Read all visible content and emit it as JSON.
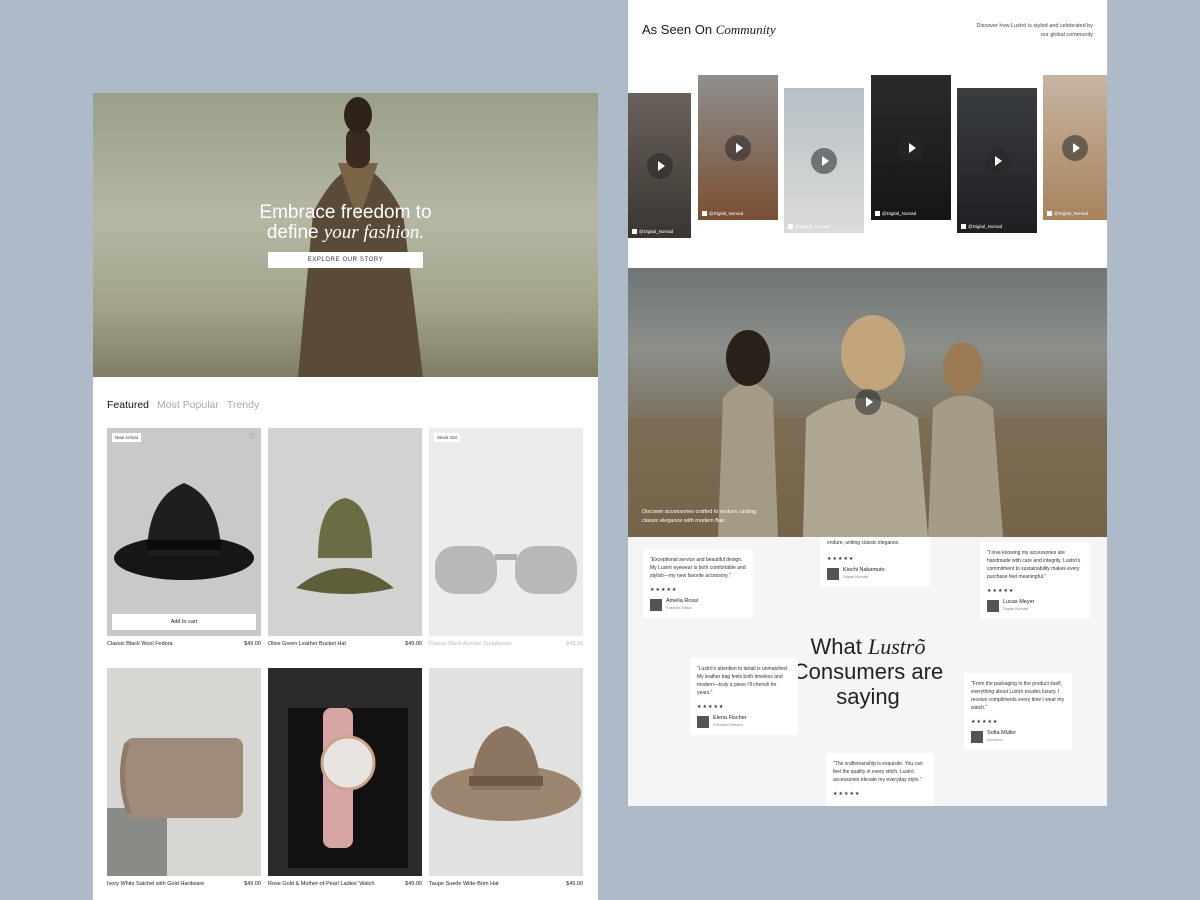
{
  "hero": {
    "title_line1": "Embrace freedom to",
    "title_line2_plain": "define ",
    "title_line2_italic": "your fashion.",
    "cta": "EXPLORE OUR STORY"
  },
  "tabs": [
    "Featured",
    "Most Popular",
    "Trendy"
  ],
  "products": [
    {
      "name": "Classic Black Wool Fedora",
      "price": "$49.00",
      "badge": "New Arrival",
      "cta": "Add to cart"
    },
    {
      "name": "Olive Green Leather Bucket Hat",
      "price": "$49.00"
    },
    {
      "name": "Classic Black Acetate Sunglasses",
      "price": "$49.00",
      "badge": "Stock Out"
    },
    {
      "name": "Ivory White Satchel with Gold Hardware",
      "price": "$49.00"
    },
    {
      "name": "Rose Gold & Mother-of-Pearl Ladies' Watch",
      "price": "$49.00"
    },
    {
      "name": "Taupe Suede Wide-Brim Hat",
      "price": "$49.00"
    }
  ],
  "community": {
    "title_plain": "As Seen On ",
    "title_italic": "Community",
    "description": "Discover how Luströ is styled and celebrated by our global community",
    "handle": "@Digital_Nomad"
  },
  "banner": {
    "text": "Discover accessories crafted to endure, uniting classic elegance with modern flair."
  },
  "testimonials": {
    "title_line1_plain": "What ",
    "title_line1_italic": "Lustrõ",
    "title_line2": "Consumers are",
    "title_line3": "saying",
    "stars": "★★★★★",
    "items": [
      {
        "quote": "\"Exceptional service and beautiful design. My Luströ eyewear is both comfortable and stylish—my new favorite accessory.\"",
        "name": "Amelia Rossi",
        "role": "Fashion Editor"
      },
      {
        "quote": "endure, uniting classic elegance.",
        "name": "Kiochi Nakamuto",
        "role": "Digital Nomad"
      },
      {
        "quote": "\"I love knowing my accessories are handmade with care and integrity. Luströ's commitment to sustainability makes every purchase feel meaningful.\"",
        "name": "Lucas Meyer",
        "role": "Digital Nomad"
      },
      {
        "quote": "\"Luströ's attention to detail is unmatched. My leather bag feels both timeless and modern—truly a piece I'll cherish for years.\"",
        "name": "Elena Fischer",
        "role": "Creative Director"
      },
      {
        "quote": "\"From the packaging to the product itself, everything about Luströ exudes luxury. I receive compliments every time I wear my watch.\"",
        "name": "Sofia Müller",
        "role": "Architect"
      },
      {
        "quote": "\"The craftsmanship is exquisite. You can feel the quality in every stitch. Luströ accessories elevate my everyday style.\""
      }
    ]
  }
}
